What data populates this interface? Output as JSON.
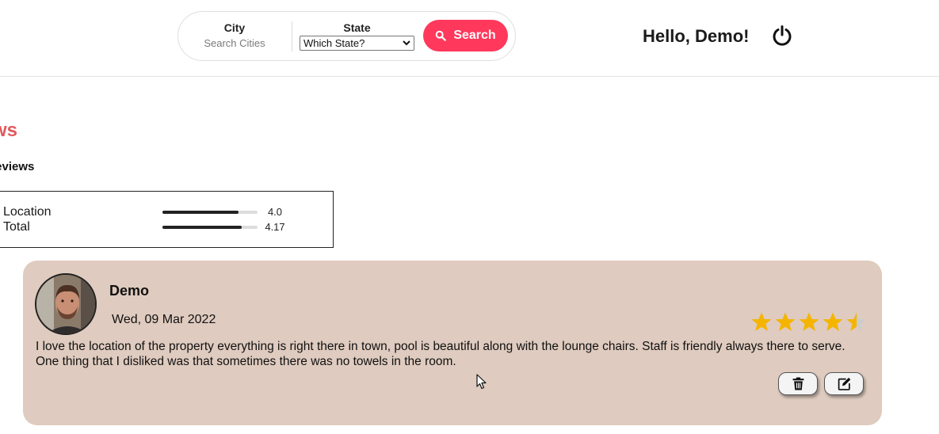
{
  "header": {
    "search": {
      "city_label": "City",
      "city_placeholder": "Search Cities",
      "state_label": "State",
      "state_selected": "Which State?",
      "search_button": "Search"
    },
    "greeting": "Hello, Demo!",
    "icons": {
      "search": "search-icon",
      "power": "power-icon"
    }
  },
  "reviews": {
    "title": "iews",
    "count_label": "l reviews",
    "ratings": [
      {
        "name": "Location",
        "value": "4.0",
        "fraction": 0.8
      },
      {
        "name": "Total",
        "value": "4.17",
        "fraction": 0.834
      }
    ],
    "items": [
      {
        "reviewer": "Demo",
        "date": "Wed, 09 Mar 2022",
        "rating": 4.5,
        "text": "I love the location of the property everything is right there in town, pool is beautiful along with the lounge chairs. Staff is friendly always there to serve. One thing that I disliked was that sometimes there was no towels in the room."
      }
    ]
  },
  "colors": {
    "accent": "#ff385c",
    "section_title": "#e05a5f",
    "card_bg": "#dfcbbf",
    "star": "#f4b400",
    "star_empty": "#cccccc"
  }
}
